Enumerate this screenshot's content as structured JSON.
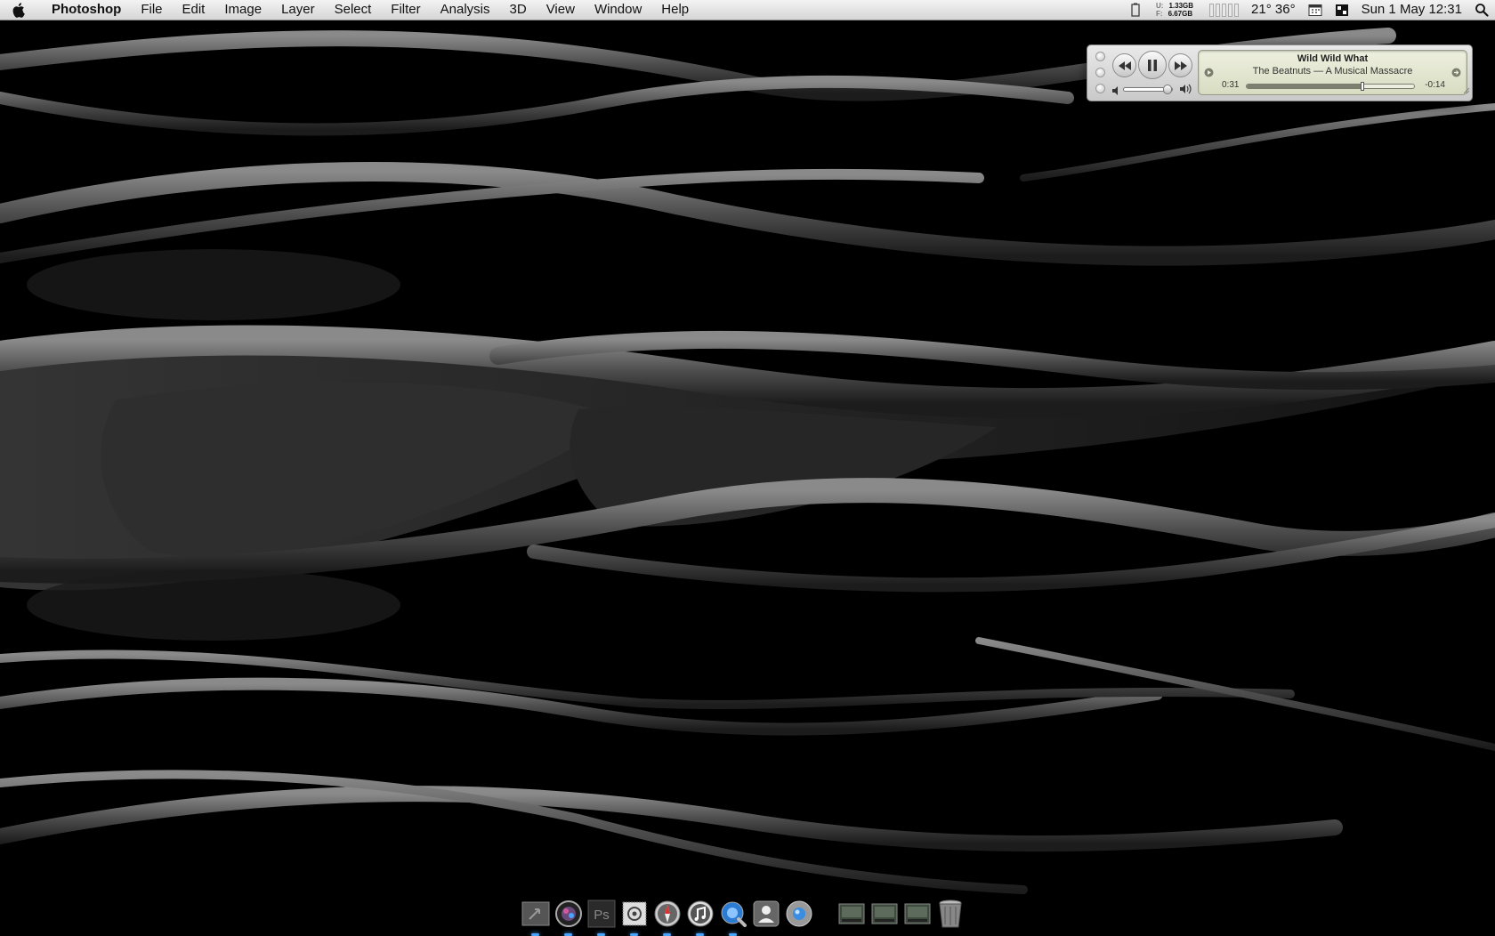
{
  "menubar": {
    "apple_icon": "apple-logo-icon",
    "app_name": "Photoshop",
    "items": [
      "File",
      "Edit",
      "Image",
      "Layer",
      "Select",
      "Filter",
      "Analysis",
      "3D",
      "View",
      "Window",
      "Help"
    ],
    "status": {
      "memory_used_label": "U:",
      "memory_used": "1.33GB",
      "memory_free_label": "F:",
      "memory_free": "6.67GB",
      "temperatures": "21° 36°",
      "date_time": "Sun 1 May  12:31"
    }
  },
  "itunes_mini": {
    "track_title": "Wild Wild What",
    "track_subtitle": "The Beatnuts — A Musical Massacre",
    "elapsed": "0:31",
    "remaining": "-0:14",
    "progress_fraction": 0.69,
    "volume_fraction": 0.9,
    "play_state": "playing"
  },
  "dock": {
    "items": [
      "applications-stack-icon",
      "aperture-icon",
      "photoshop-icon",
      "mail-stamp-icon",
      "safari-compass-icon",
      "itunes-note-icon",
      "quicktime-icon",
      "address-book-icon",
      "network-globe-icon",
      "drive-icon",
      "drive-icon",
      "drive-icon",
      "trash-icon"
    ]
  },
  "colors": {
    "menubar": "#e4e4e4",
    "wallpaper_flame": "#5a5a5a",
    "lcd": "#e2e5cf",
    "dock_indicator": "#4aa3ff"
  }
}
